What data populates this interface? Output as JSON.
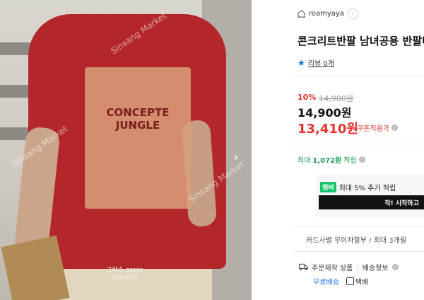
{
  "image": {
    "shirt_headline": "CONCEPTE JUNGLE",
    "caption_line1": "그라스 grass",
    "caption_line2": "[sasaol]",
    "watermarks": [
      "Sinsang Market",
      "Sinsang Market",
      "Sinsang Market"
    ]
  },
  "seller": {
    "name": "roamyaya"
  },
  "product": {
    "title": "콘크리트반팔 남녀공용 반팔티",
    "review_label": "리뷰 0개"
  },
  "price": {
    "discount_rate": "10%",
    "original": "14,900원",
    "sale": "14,900원",
    "coupon_price": "13,410원",
    "coupon_label": "쿠폰적용가"
  },
  "points": {
    "prefix": "최대",
    "amount": "1,072원",
    "suffix": "적립"
  },
  "membership": {
    "badge": "멤버",
    "text": "최대 5% 추가 적립",
    "button": "작! 시작하고"
  },
  "card": {
    "text": "카드사별 무이자할부 / 최대 3개월"
  },
  "shipping": {
    "made_to_order": "주문제작 상품",
    "delivery_info": "배송정보",
    "free": "무료배송",
    "courier": "택배"
  },
  "colors": {
    "accent_red": "#e3342f",
    "points_green": "#1f9d55",
    "link_blue": "#1b6fe8",
    "member_green": "#16c46b"
  },
  "icons": [
    "store-icon",
    "chevron-right-icon",
    "star-icon",
    "info-icon",
    "truck-icon",
    "next-arrow-icon",
    "courier-icon"
  ]
}
